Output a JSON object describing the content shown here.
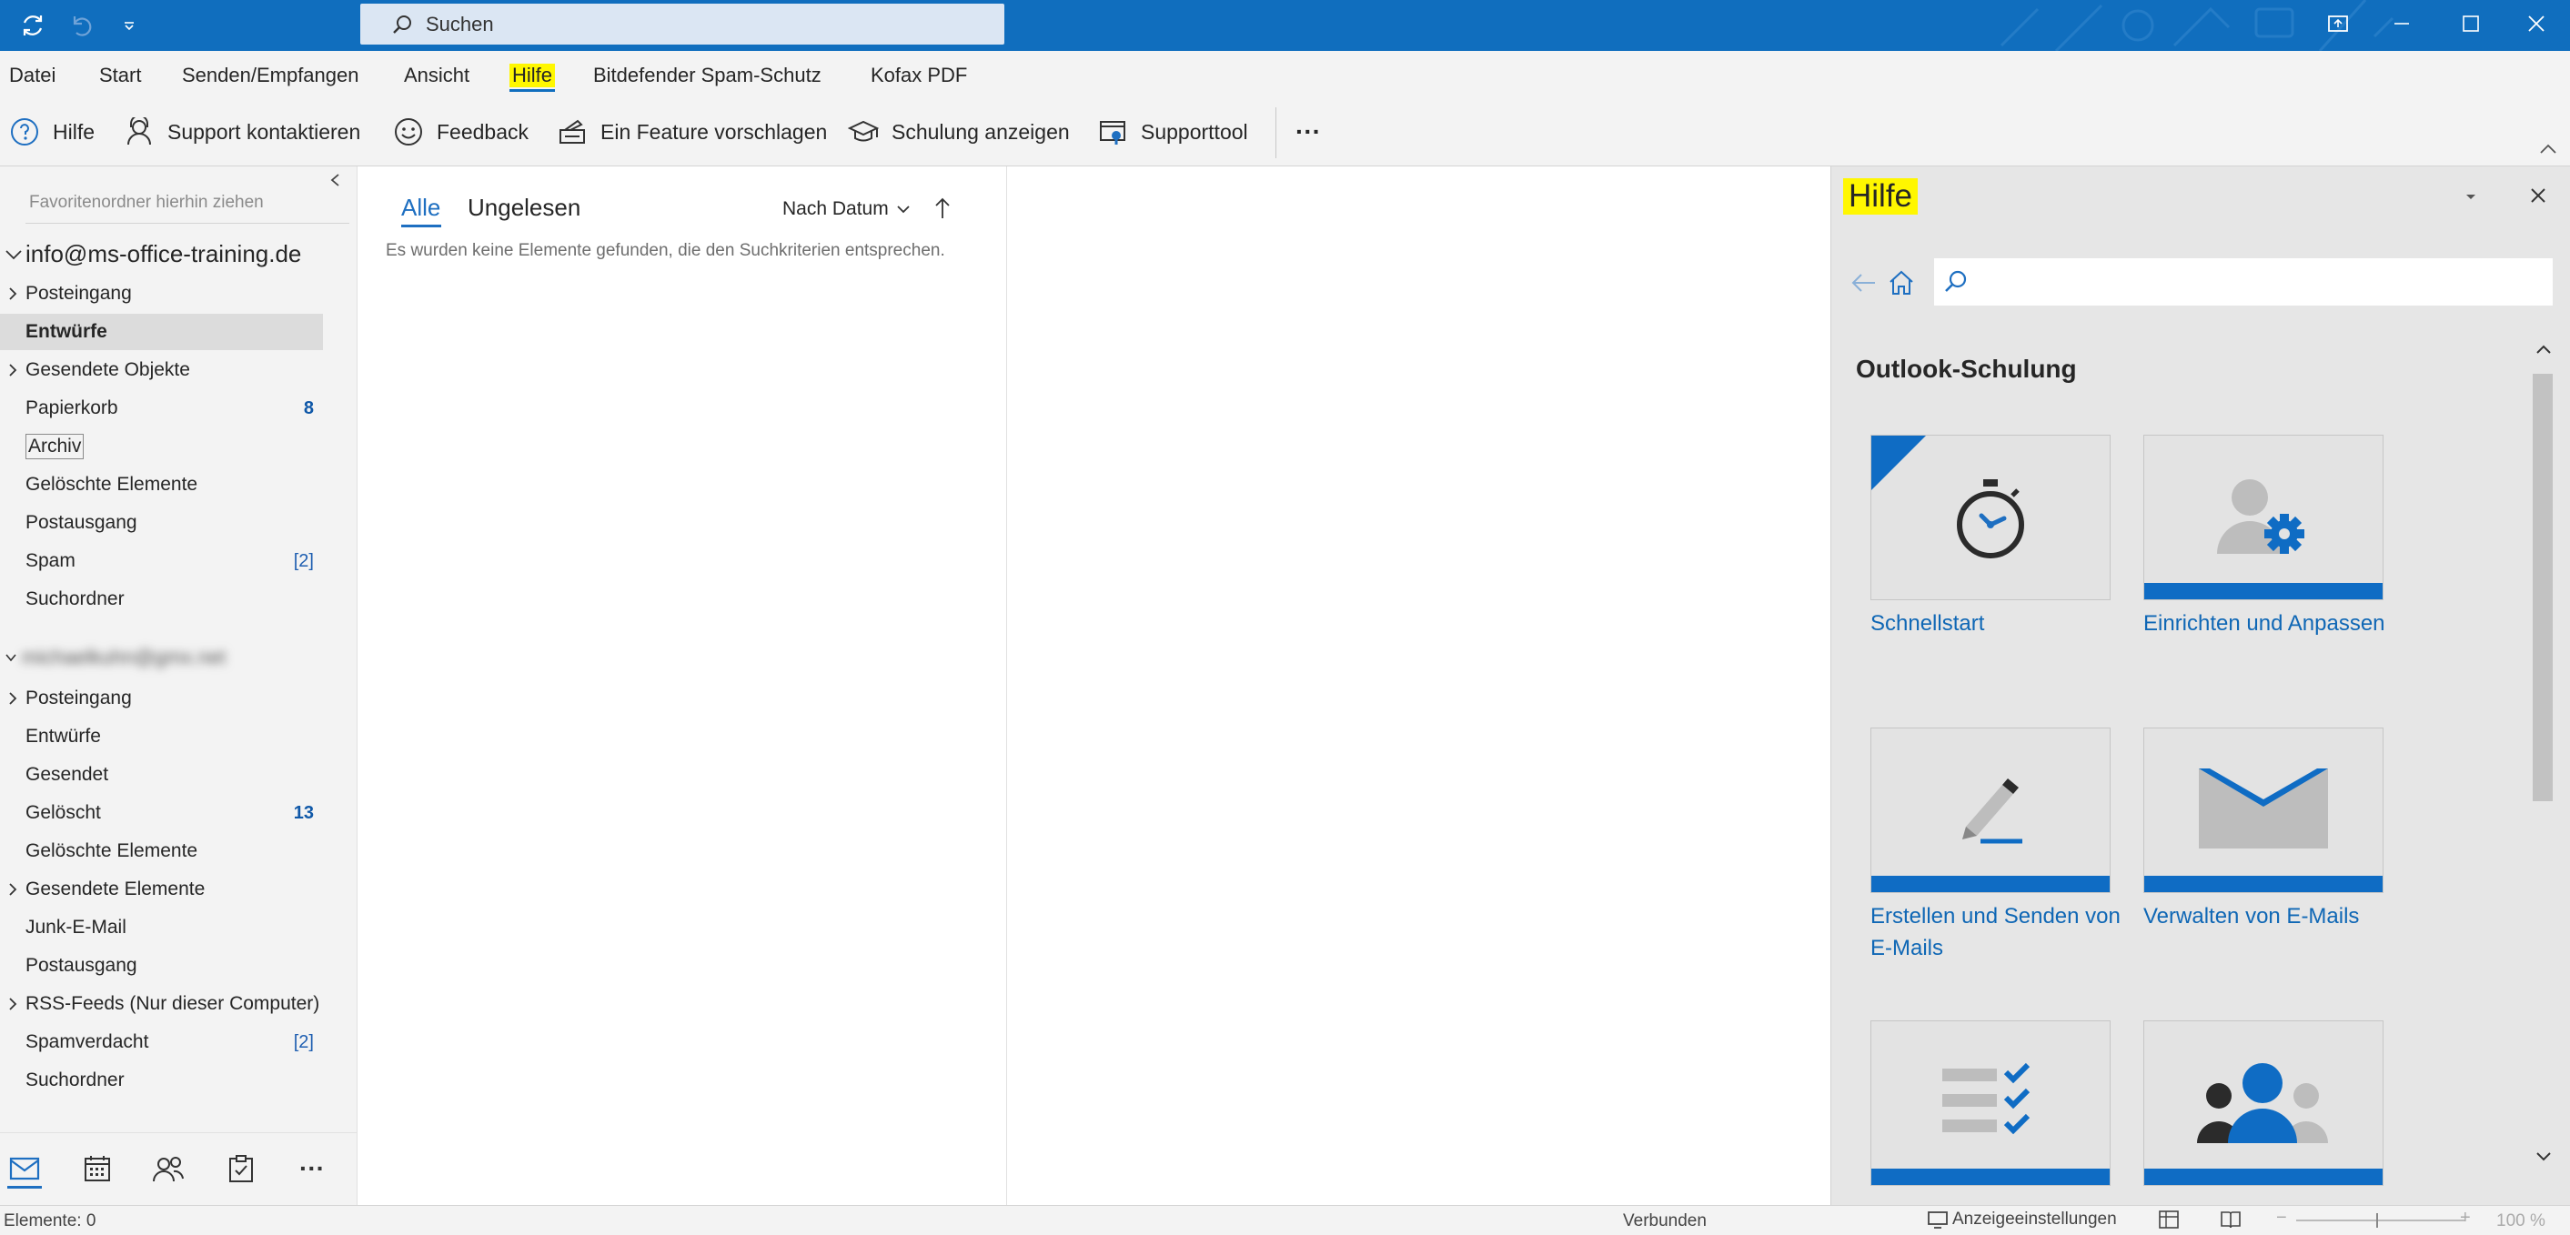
{
  "titlebar": {
    "search_label": "Suchen",
    "accent": "#106ebe"
  },
  "menu": {
    "items": [
      "Datei",
      "Start",
      "Senden/Empfangen",
      "Ansicht",
      "Hilfe",
      "Bitdefender Spam-Schutz",
      "Kofax PDF"
    ],
    "active": "Hilfe"
  },
  "ribbon": {
    "buttons": [
      {
        "label": "Hilfe",
        "icon": "help-circle-icon"
      },
      {
        "label": "Support kontaktieren",
        "icon": "support-person-icon"
      },
      {
        "label": "Feedback",
        "icon": "smiley-icon"
      },
      {
        "label": "Ein Feature vorschlagen",
        "icon": "suggest-feature-icon"
      },
      {
        "label": "Schulung anzeigen",
        "icon": "graduation-cap-icon"
      },
      {
        "label": "Supporttool",
        "icon": "support-tool-icon"
      }
    ],
    "more": "···"
  },
  "folders": {
    "favorites_hint": "Favoritenordner hierhin ziehen",
    "account1": {
      "name": "info@ms-office-training.de",
      "items": [
        {
          "name": "Posteingang",
          "expandable": true,
          "count": ""
        },
        {
          "name": "Entwürfe",
          "expandable": false,
          "count": "",
          "selected": true
        },
        {
          "name": "Gesendete Objekte",
          "expandable": true,
          "count": ""
        },
        {
          "name": "Papierkorb",
          "expandable": false,
          "count": "8"
        },
        {
          "name": "Archiv",
          "expandable": false,
          "count": ""
        },
        {
          "name": "Gelöschte Elemente",
          "expandable": false,
          "count": ""
        },
        {
          "name": "Postausgang",
          "expandable": false,
          "count": ""
        },
        {
          "name": "Spam",
          "expandable": false,
          "count": "[2]"
        },
        {
          "name": "Suchordner",
          "expandable": false,
          "count": ""
        }
      ]
    },
    "account2": {
      "name": "michaelkuhn@gmx.net",
      "items": [
        {
          "name": "Posteingang",
          "expandable": true,
          "count": ""
        },
        {
          "name": "Entwürfe",
          "expandable": false,
          "count": ""
        },
        {
          "name": "Gesendet",
          "expandable": false,
          "count": ""
        },
        {
          "name": "Gelöscht",
          "expandable": false,
          "count": "13"
        },
        {
          "name": "Gelöschte Elemente",
          "expandable": false,
          "count": ""
        },
        {
          "name": "Gesendete Elemente",
          "expandable": true,
          "count": ""
        },
        {
          "name": "Junk-E-Mail",
          "expandable": false,
          "count": ""
        },
        {
          "name": "Postausgang",
          "expandable": false,
          "count": ""
        },
        {
          "name": "RSS-Feeds (Nur dieser Computer)",
          "expandable": true,
          "count": ""
        },
        {
          "name": "Spamverdacht",
          "expandable": false,
          "count": "[2]"
        },
        {
          "name": "Suchordner",
          "expandable": false,
          "count": ""
        }
      ]
    }
  },
  "messagelist": {
    "tab_all": "Alle",
    "tab_unread": "Ungelesen",
    "sort": "Nach Datum",
    "empty": "Es wurden keine Elemente gefunden, die den Suchkriterien entsprechen."
  },
  "help": {
    "title": "Hilfe",
    "section": "Outlook-Schulung",
    "cards": [
      {
        "label": "Schnellstart",
        "icon": "stopwatch-icon"
      },
      {
        "label": "Einrichten und Anpassen",
        "icon": "person-gear-icon"
      },
      {
        "label": "Erstellen und Senden von E-Mails",
        "icon": "pencil-icon"
      },
      {
        "label": "Verwalten von E-Mails",
        "icon": "envelope-icon"
      },
      {
        "label": "",
        "icon": "checklist-icon"
      },
      {
        "label": "",
        "icon": "people-icon"
      }
    ]
  },
  "status": {
    "items": "Elemente: 0",
    "connection": "Verbunden",
    "display_settings": "Anzeigeeinstellungen",
    "zoom": "100 %"
  }
}
